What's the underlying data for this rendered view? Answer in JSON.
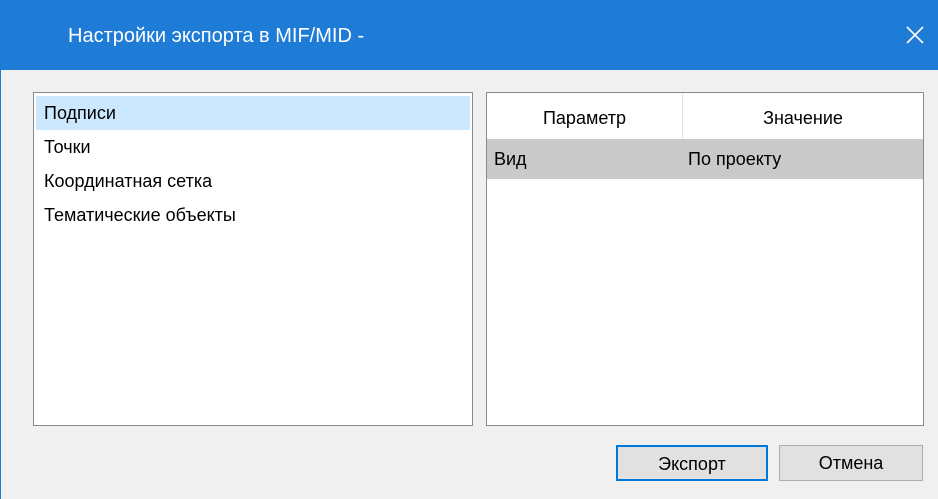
{
  "window": {
    "title": "Настройки экспорта в MIF/MID -",
    "close_icon": "close-icon"
  },
  "categories": {
    "items": [
      {
        "label": "Подписи",
        "selected": true
      },
      {
        "label": "Точки",
        "selected": false
      },
      {
        "label": "Координатная сетка",
        "selected": false
      },
      {
        "label": "Тематические объекты",
        "selected": false
      }
    ]
  },
  "properties": {
    "columns": [
      "Параметр",
      "Значение"
    ],
    "rows": [
      {
        "param": "Вид",
        "value": "По проекту",
        "selected": true
      }
    ]
  },
  "buttons": {
    "export_label": "Экспорт",
    "cancel_label": "Отмена"
  },
  "colors": {
    "titlebar": "#1e7bd6",
    "selection": "#cce8ff",
    "row_highlight": "#c9c9c9",
    "default_button_border": "#0078d7"
  }
}
